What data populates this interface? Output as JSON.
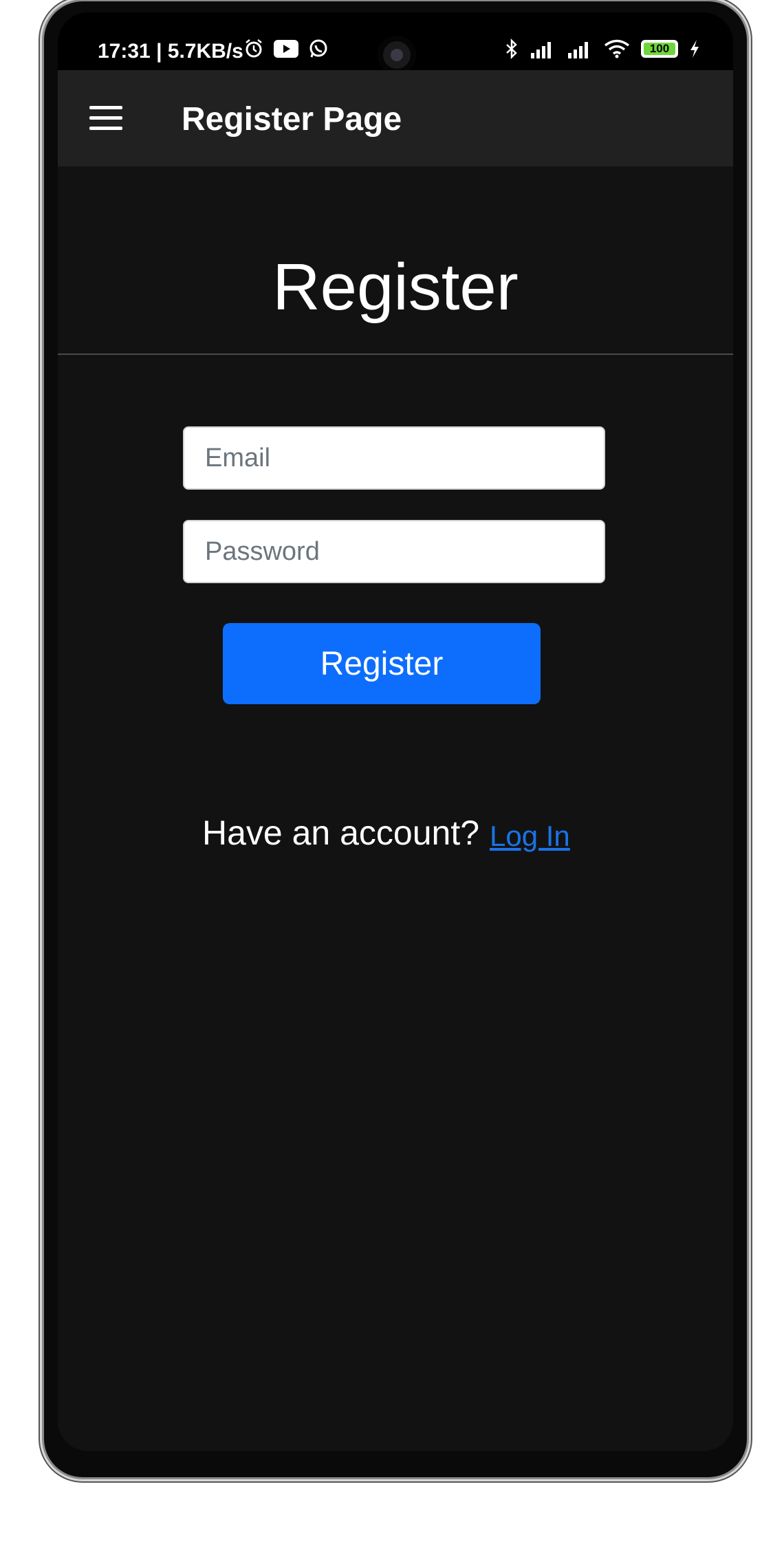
{
  "status_bar": {
    "time": "17:31 | 5.7KB/s",
    "icons_left": [
      "alarm-icon",
      "youtube-icon",
      "whatsapp-icon"
    ],
    "icons_right": [
      "bluetooth-icon",
      "signal-icon",
      "signal-icon",
      "wifi-icon",
      "battery-icon",
      "charging-icon"
    ],
    "battery": "100"
  },
  "app_bar": {
    "menu_icon": "hamburger-menu-icon",
    "title": "Register Page"
  },
  "main": {
    "heading": "Register",
    "email_placeholder": "Email",
    "password_placeholder": "Password",
    "register_button": "Register",
    "have_account_text": "Have an account?",
    "login_link": "Log In"
  },
  "colors": {
    "background": "#121212",
    "app_bar": "#212121",
    "primary_button": "#0d6efd",
    "link": "#1a73e8"
  }
}
